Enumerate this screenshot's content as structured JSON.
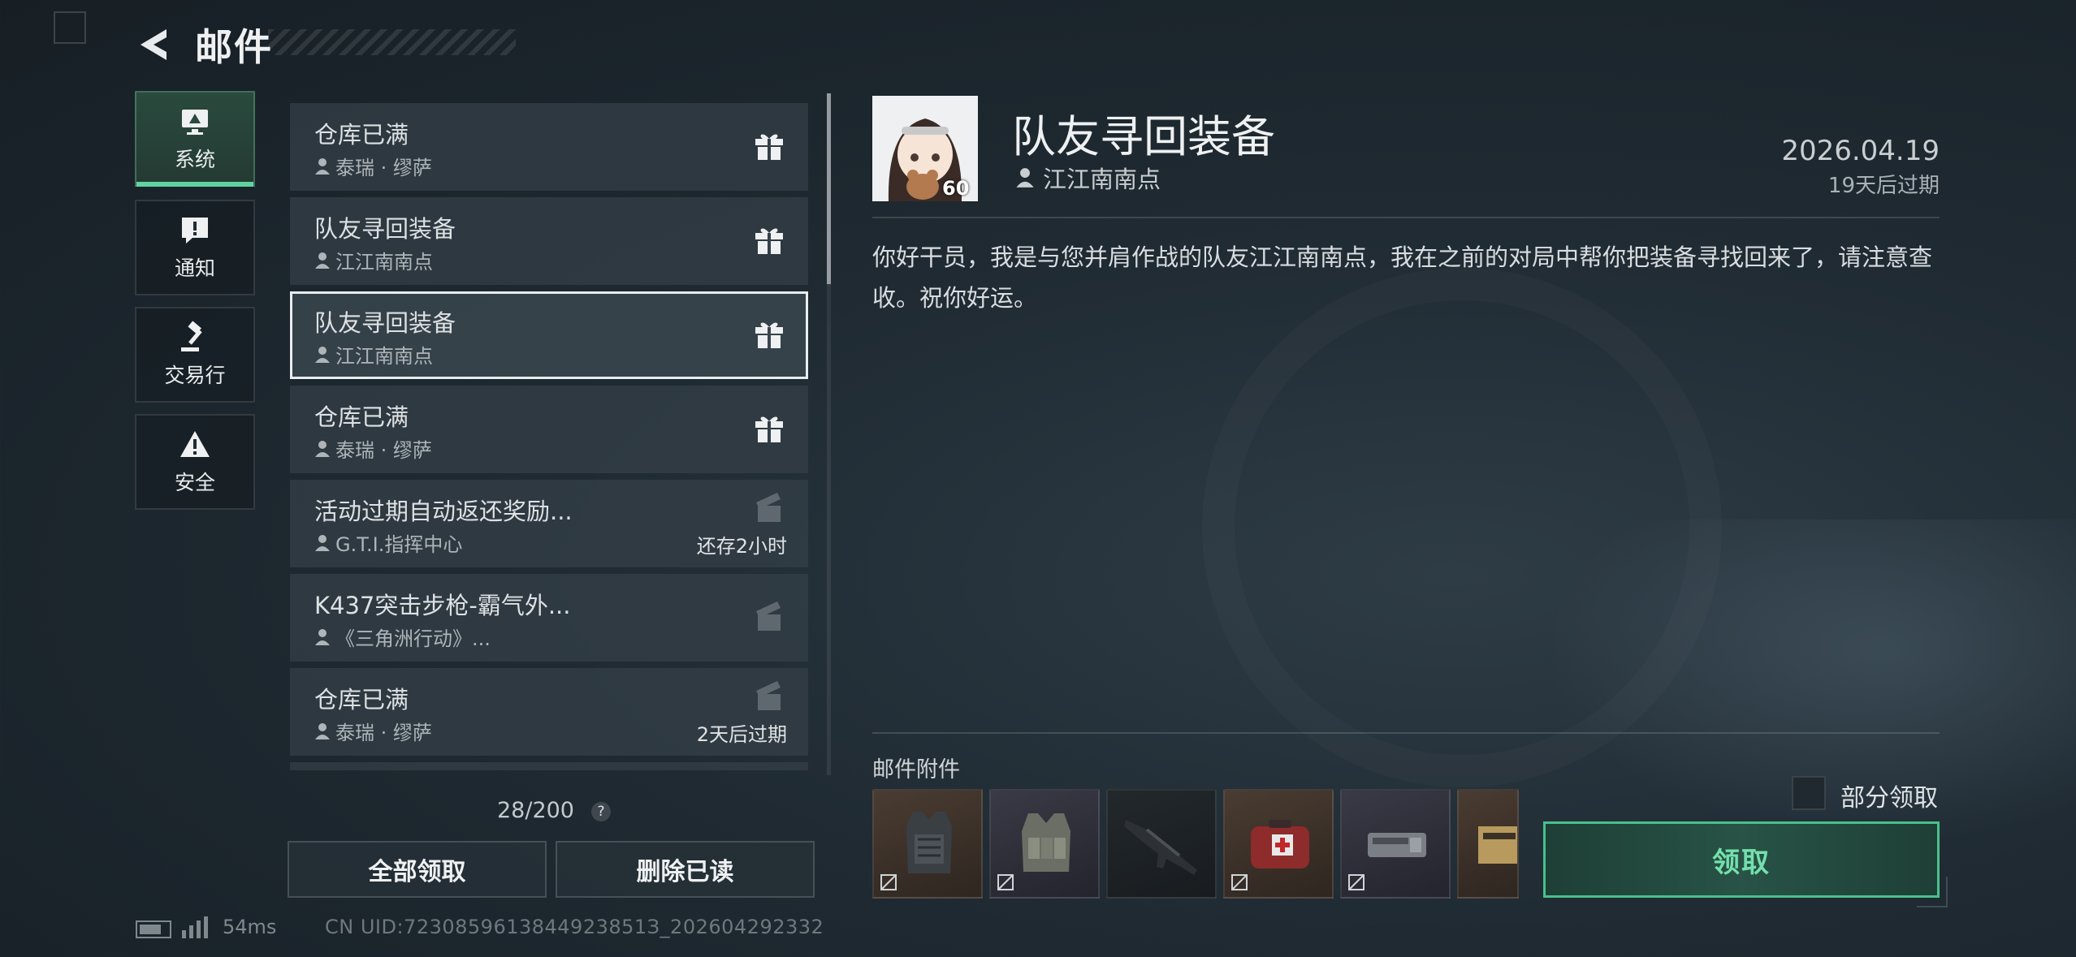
{
  "header": {
    "title": "邮件"
  },
  "categories": [
    {
      "label": "系统",
      "icon": "monitor-icon",
      "active": true
    },
    {
      "label": "通知",
      "icon": "alert-bubble-icon",
      "active": false
    },
    {
      "label": "交易行",
      "icon": "gavel-icon",
      "active": false
    },
    {
      "label": "安全",
      "icon": "warning-triangle-icon",
      "active": false
    }
  ],
  "mails": [
    {
      "title": "仓库已满",
      "sender": "泰瑞 · 缪萨",
      "status": ""
    },
    {
      "title": "队友寻回装备",
      "sender": "江江南南点",
      "status": ""
    },
    {
      "title": "队友寻回装备",
      "sender": "江江南南点",
      "status": ""
    },
    {
      "title": "仓库已满",
      "sender": "泰瑞 · 缪萨",
      "status": ""
    },
    {
      "title": "活动过期自动返还奖励...",
      "sender": "G.T.I.指挥中心",
      "status": "还存2小时"
    },
    {
      "title": "K437突击步枪-霸气外...",
      "sender": "《三角洲行动》...",
      "status": ""
    },
    {
      "title": "仓库已满",
      "sender": "泰瑞 · 缪萨",
      "status": "2天后过期"
    }
  ],
  "list_footer": {
    "count": "28/200",
    "help": "?"
  },
  "buttons": {
    "claim_all": "全部领取",
    "delete_read": "删除已读"
  },
  "status_bar": {
    "ping": "54ms",
    "uid": "CN UID:7230859613844923851З_202604292332"
  },
  "detail": {
    "title": "队友寻回装备",
    "sender": "江江南南点",
    "avatar_level": "60",
    "date": "2026.04.19",
    "expiry": "19天后过期",
    "body": "你好干员，我是与您并肩作战的队友江江南南点，我在之前的对局中帮你把装备寻找回来了，请注意查收。祝你好运。",
    "attachments_label": "邮件附件",
    "attachments": [
      "armor-vest-icon",
      "chest-rig-icon",
      "rifle-icon",
      "medkit-icon",
      "case-icon",
      "ammo-box-icon"
    ],
    "partial_claim_label": "部分领取",
    "claim_label": "领取"
  },
  "colors": {
    "accent": "#5fd3a0",
    "claim_text": "#74e0ad"
  }
}
